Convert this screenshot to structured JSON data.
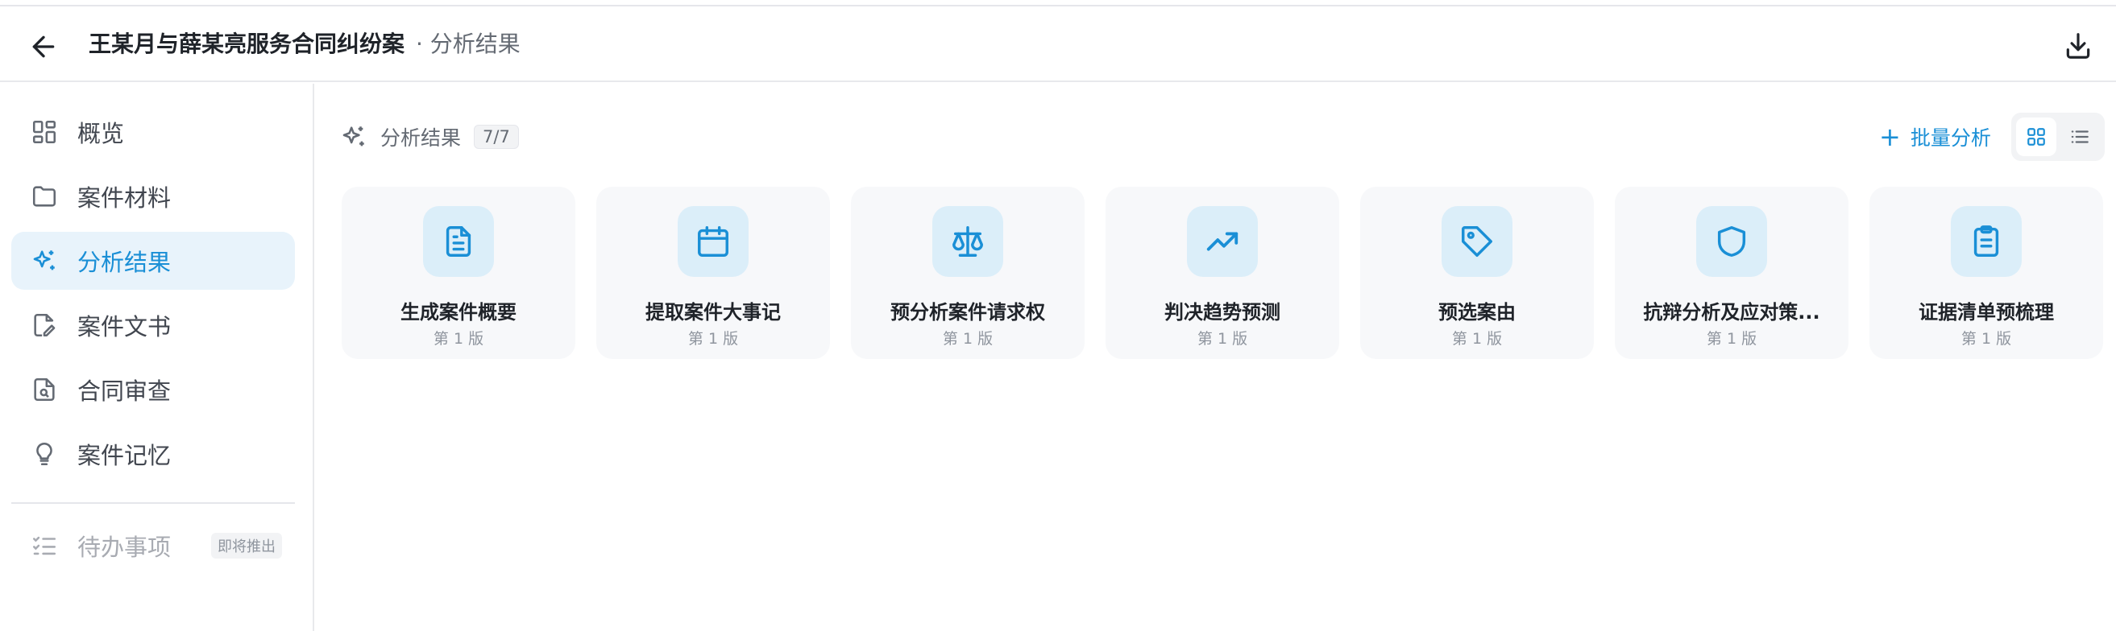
{
  "header": {
    "title": "王某月与薛某亮服务合同纠纷案",
    "subtitle": "· 分析结果",
    "back_icon": "arrow-left-icon",
    "download_icon": "download-icon"
  },
  "sidebar": {
    "items": [
      {
        "label": "概览",
        "icon": "dashboard-icon",
        "active": false
      },
      {
        "label": "案件材料",
        "icon": "folder-icon",
        "active": false
      },
      {
        "label": "分析结果",
        "icon": "sparkles-icon",
        "active": true
      },
      {
        "label": "案件文书",
        "icon": "document-pen-icon",
        "active": false
      },
      {
        "label": "合同审查",
        "icon": "document-search-icon",
        "active": false
      },
      {
        "label": "案件记忆",
        "icon": "lightbulb-icon",
        "active": false
      }
    ],
    "todo": {
      "label": "待办事项",
      "icon": "checklist-icon",
      "badge": "即将推出",
      "disabled": true
    }
  },
  "main": {
    "section_title": "分析结果",
    "count": "7/7",
    "batch_label": "批量分析",
    "batch_prefix": "+",
    "view": "grid",
    "cards": [
      {
        "title": "生成案件概要",
        "version": "第 1 版",
        "icon": "file-text-icon"
      },
      {
        "title": "提取案件大事记",
        "version": "第 1 版",
        "icon": "calendar-icon"
      },
      {
        "title": "预分析案件请求权",
        "version": "第 1 版",
        "icon": "scale-icon"
      },
      {
        "title": "判决趋势预测",
        "version": "第 1 版",
        "icon": "trending-up-icon"
      },
      {
        "title": "预选案由",
        "version": "第 1 版",
        "icon": "tag-icon"
      },
      {
        "title": "抗辩分析及应对策...",
        "version": "第 1 版",
        "icon": "shield-icon"
      },
      {
        "title": "证据清单预梳理",
        "version": "第 1 版",
        "icon": "clipboard-icon"
      }
    ]
  },
  "colors": {
    "accent": "#1a8fd6",
    "active_bg": "#e8f3fb",
    "card_bg": "#f7f8fa",
    "icon_bg": "#dbeef9"
  }
}
